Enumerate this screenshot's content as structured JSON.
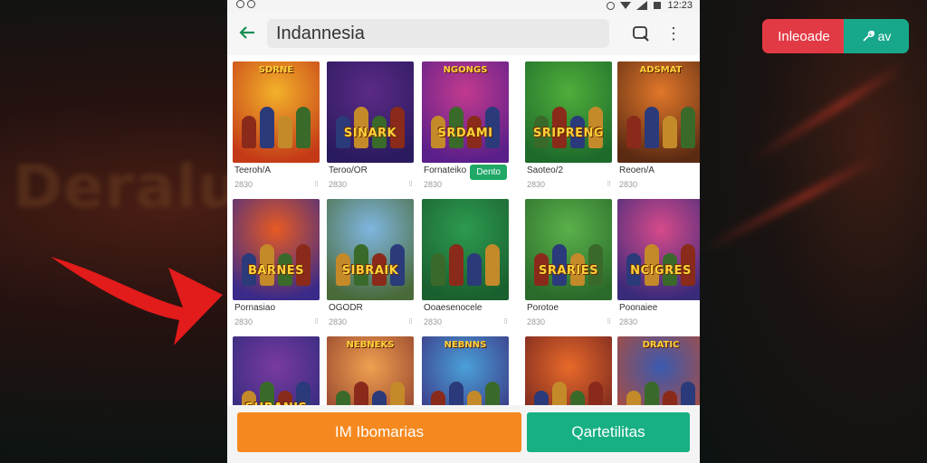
{
  "statusbar": {
    "time": "12:23"
  },
  "header": {
    "search_value": "Indannesia"
  },
  "background": {
    "blurred_word": "Deralus"
  },
  "overlay": {
    "red_button_label": "Inleoade",
    "green_button_label": "av"
  },
  "apps": [
    {
      "name": "Teeroh/A",
      "size": "2830",
      "logo": "",
      "top_logo": "SDRNE",
      "palette": [
        "#f3b12a",
        "#c43a17"
      ]
    },
    {
      "name": "Teroo/OR",
      "size": "2830",
      "logo": "SINARK",
      "top_logo": "",
      "palette": [
        "#5b2a86",
        "#2a1a5e"
      ]
    },
    {
      "name": "Fornateiko",
      "size": "2830",
      "logo": "SRDAMI",
      "top_logo": "NGONGS",
      "palette": [
        "#c23a8e",
        "#5a1f8a"
      ],
      "install_label": "Dento"
    },
    {
      "name": "Saoteo/2",
      "size": "2830",
      "logo": "SRIPRENG",
      "top_logo": "",
      "palette": [
        "#4fae3a",
        "#1d6a2b"
      ]
    },
    {
      "name": "Reoen/A",
      "size": "2830",
      "logo": "",
      "top_logo": "ADSMAT",
      "palette": [
        "#e0772a",
        "#5b2a12"
      ]
    },
    {
      "name": "Pornasiao",
      "size": "2830",
      "logo": "BARNES",
      "top_logo": "",
      "palette": [
        "#e65a23",
        "#3a2a8a"
      ]
    },
    {
      "name": "OGODR",
      "size": "2830",
      "logo": "SIBRAIK",
      "top_logo": "",
      "palette": [
        "#7fb6e0",
        "#4a6a3a"
      ]
    },
    {
      "name": "Ooaesenocele",
      "size": "2830",
      "logo": "",
      "top_logo": "",
      "palette": [
        "#2c9a4f",
        "#1a5f2e"
      ]
    },
    {
      "name": "Porotoe",
      "size": "2830",
      "logo": "SRARIES",
      "top_logo": "",
      "palette": [
        "#5ab04a",
        "#2a6a2a"
      ]
    },
    {
      "name": "Poonaiee",
      "size": "2830",
      "logo": "NCIGRES",
      "top_logo": "",
      "palette": [
        "#d64a8a",
        "#3a2a7a"
      ]
    },
    {
      "name": "",
      "size": "",
      "logo": "SHRANIS",
      "top_logo": "",
      "palette": [
        "#7a3aa0",
        "#2a2a7a"
      ]
    },
    {
      "name": "",
      "size": "",
      "logo": "",
      "top_logo": "NEBNEKS",
      "palette": [
        "#f0a050",
        "#8a3a2a"
      ]
    },
    {
      "name": "",
      "size": "",
      "logo": "",
      "top_logo": "NEBNNS",
      "palette": [
        "#4aa0d8",
        "#3a2a7a"
      ]
    },
    {
      "name": "",
      "size": "",
      "logo": "",
      "top_logo": "",
      "palette": [
        "#e86a2a",
        "#6a1e1e"
      ]
    },
    {
      "name": "",
      "size": "",
      "logo": "",
      "top_logo": "DRATIC",
      "palette": [
        "#3a5ab0",
        "#c04a2a"
      ]
    }
  ],
  "bottom": {
    "primary_label": "IM Ibomarias",
    "secondary_label": "Qartetilitas"
  },
  "colors": {
    "accent_green": "#17b084",
    "accent_orange": "#f5891f",
    "accent_red": "#e23a45"
  }
}
